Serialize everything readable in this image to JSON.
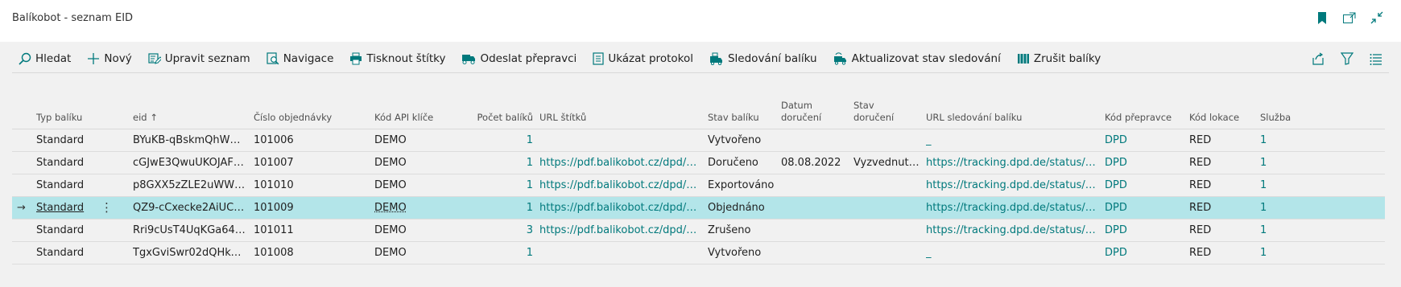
{
  "window": {
    "title": "Balíkobot - seznam EID",
    "icons": [
      "bookmark-icon",
      "open-in-new-window-icon",
      "collapse-icon"
    ]
  },
  "actions": [
    {
      "label": "Hledat",
      "icon": "search-icon"
    },
    {
      "label": "Nový",
      "icon": "plus-icon"
    },
    {
      "label": "Upravit seznam",
      "icon": "edit-list-icon"
    },
    {
      "label": "Navigace",
      "icon": "navigate-icon"
    },
    {
      "label": "Tisknout štítky",
      "icon": "printer-icon"
    },
    {
      "label": "Odeslat přepravci",
      "icon": "truck-icon"
    },
    {
      "label": "Ukázat protokol",
      "icon": "document-icon"
    },
    {
      "label": "Sledování balíku",
      "icon": "tracking-icon"
    },
    {
      "label": "Aktualizovat stav sledování",
      "icon": "update-tracking-icon"
    },
    {
      "label": "Zrušit balíky",
      "icon": "cancel-packages-icon"
    }
  ],
  "action_right_icons": [
    "share-icon",
    "filter-icon",
    "list-view-icon"
  ],
  "columns": {
    "typ": "Typ balíku",
    "eid": "eid ↑",
    "cislo": "Číslo objednávky",
    "kod_api": "Kód API klíče",
    "pocet": "Počet balíků",
    "url_stitku": "URL štítků",
    "stav": "Stav balíku",
    "datum_1": "Datum",
    "datum_2": "doručení",
    "stavdor_1": "Stav",
    "stavdor_2": "doručení",
    "url_sled": "URL sledování balíku",
    "kod_prepr": "Kód přepravce",
    "kod_lok": "Kód lokace",
    "sluzba": "Služba"
  },
  "selected_row": 3,
  "rows": [
    {
      "typ": "Standard",
      "eid": "BYuKB-qBskmQhW4...",
      "cislo": "101006",
      "kod_api": "DEMO",
      "pocet": "1",
      "url_stitku": "",
      "stav": "Vytvořeno",
      "datum": "",
      "stav_doruceni": "",
      "url_sled": "_",
      "kod_prepr": "DPD",
      "kod_lok": "RED",
      "sluzba": "1"
    },
    {
      "typ": "Standard",
      "eid": "cGJwE3QwuUKOJAFq...",
      "cislo": "101007",
      "kod_api": "DEMO",
      "pocet": "1",
      "url_stitku": "https://pdf.balikobot.cz/dpd/eN...",
      "stav": "Doručeno",
      "datum": "08.08.2022",
      "stav_doruceni": "Vyzvednutí ...",
      "url_sled": "https://tracking.dpd.de/status/cs_...",
      "kod_prepr": "DPD",
      "kod_lok": "RED",
      "sluzba": "1"
    },
    {
      "typ": "Standard",
      "eid": "p8GXX5zZLE2uWWvc...",
      "cislo": "101010",
      "kod_api": "DEMO",
      "pocet": "1",
      "url_stitku": "https://pdf.balikobot.cz/dpd/eN...",
      "stav": "Exportováno",
      "datum": "",
      "stav_doruceni": "",
      "url_sled": "https://tracking.dpd.de/status/cs_...",
      "kod_prepr": "DPD",
      "kod_lok": "RED",
      "sluzba": "1"
    },
    {
      "typ": "Standard",
      "eid": "QZ9-cCxecke2AiUC4...",
      "cislo": "101009",
      "kod_api": "DEMO",
      "pocet": "1",
      "url_stitku": "https://pdf.balikobot.cz/dpd/eN...",
      "stav": "Objednáno",
      "datum": "",
      "stav_doruceni": "",
      "url_sled": "https://tracking.dpd.de/status/cs_...",
      "kod_prepr": "DPD",
      "kod_lok": "RED",
      "sluzba": "1"
    },
    {
      "typ": "Standard",
      "eid": "Rri9cUsT4UqKGa64M...",
      "cislo": "101011",
      "kod_api": "DEMO",
      "pocet": "3",
      "url_stitku": "https://pdf.balikobot.cz/dpd/eN...",
      "stav": "Zrušeno",
      "datum": "",
      "stav_doruceni": "",
      "url_sled": "https://tracking.dpd.de/status/cs_...",
      "kod_prepr": "DPD",
      "kod_lok": "RED",
      "sluzba": "1"
    },
    {
      "typ": "Standard",
      "eid": "TgxGviSwr02dQHkujx...",
      "cislo": "101008",
      "kod_api": "DEMO",
      "pocet": "1",
      "url_stitku": "",
      "stav": "Vytvořeno",
      "datum": "",
      "stav_doruceni": "",
      "url_sled": "_",
      "kod_prepr": "DPD",
      "kod_lok": "RED",
      "sluzba": "1"
    }
  ],
  "colors": {
    "accent": "#00797c",
    "selected_row": "#b3e5e9",
    "background": "#f1f1f1",
    "titlebar": "#ffffff"
  }
}
